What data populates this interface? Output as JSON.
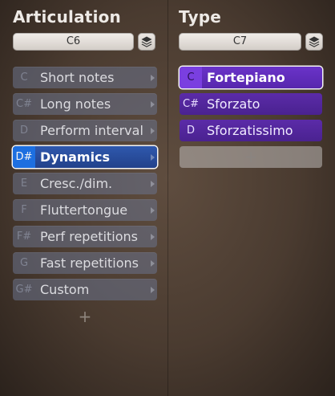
{
  "articulation": {
    "title": "Articulation",
    "note": "C6",
    "items": [
      {
        "key": "C",
        "label": "Short notes",
        "selected": false
      },
      {
        "key": "C#",
        "label": "Long notes",
        "selected": false
      },
      {
        "key": "D",
        "label": "Perform interval",
        "selected": false
      },
      {
        "key": "D#",
        "label": "Dynamics",
        "selected": true
      },
      {
        "key": "E",
        "label": "Cresc./dim.",
        "selected": false
      },
      {
        "key": "F",
        "label": "Fluttertongue",
        "selected": false
      },
      {
        "key": "F#",
        "label": "Perf repetitions",
        "selected": false
      },
      {
        "key": "G",
        "label": "Fast repetitions",
        "selected": false
      },
      {
        "key": "G#",
        "label": "Custom",
        "selected": false
      }
    ],
    "add_label": "+"
  },
  "type": {
    "title": "Type",
    "note": "C7",
    "items": [
      {
        "key": "C",
        "label": "Fortepiano",
        "selected": true
      },
      {
        "key": "C#",
        "label": "Sforzato",
        "selected": false
      },
      {
        "key": "D",
        "label": "Sforzatissimo",
        "selected": false
      }
    ],
    "add_label": "+"
  },
  "colors": {
    "articulation_item": "#5c6477",
    "articulation_selected": "#2a4c9c",
    "type_item": "#512699",
    "type_selected": "#6030bb"
  },
  "icons": {
    "stack": "layers-icon",
    "chevron": "chevron-right-icon"
  }
}
